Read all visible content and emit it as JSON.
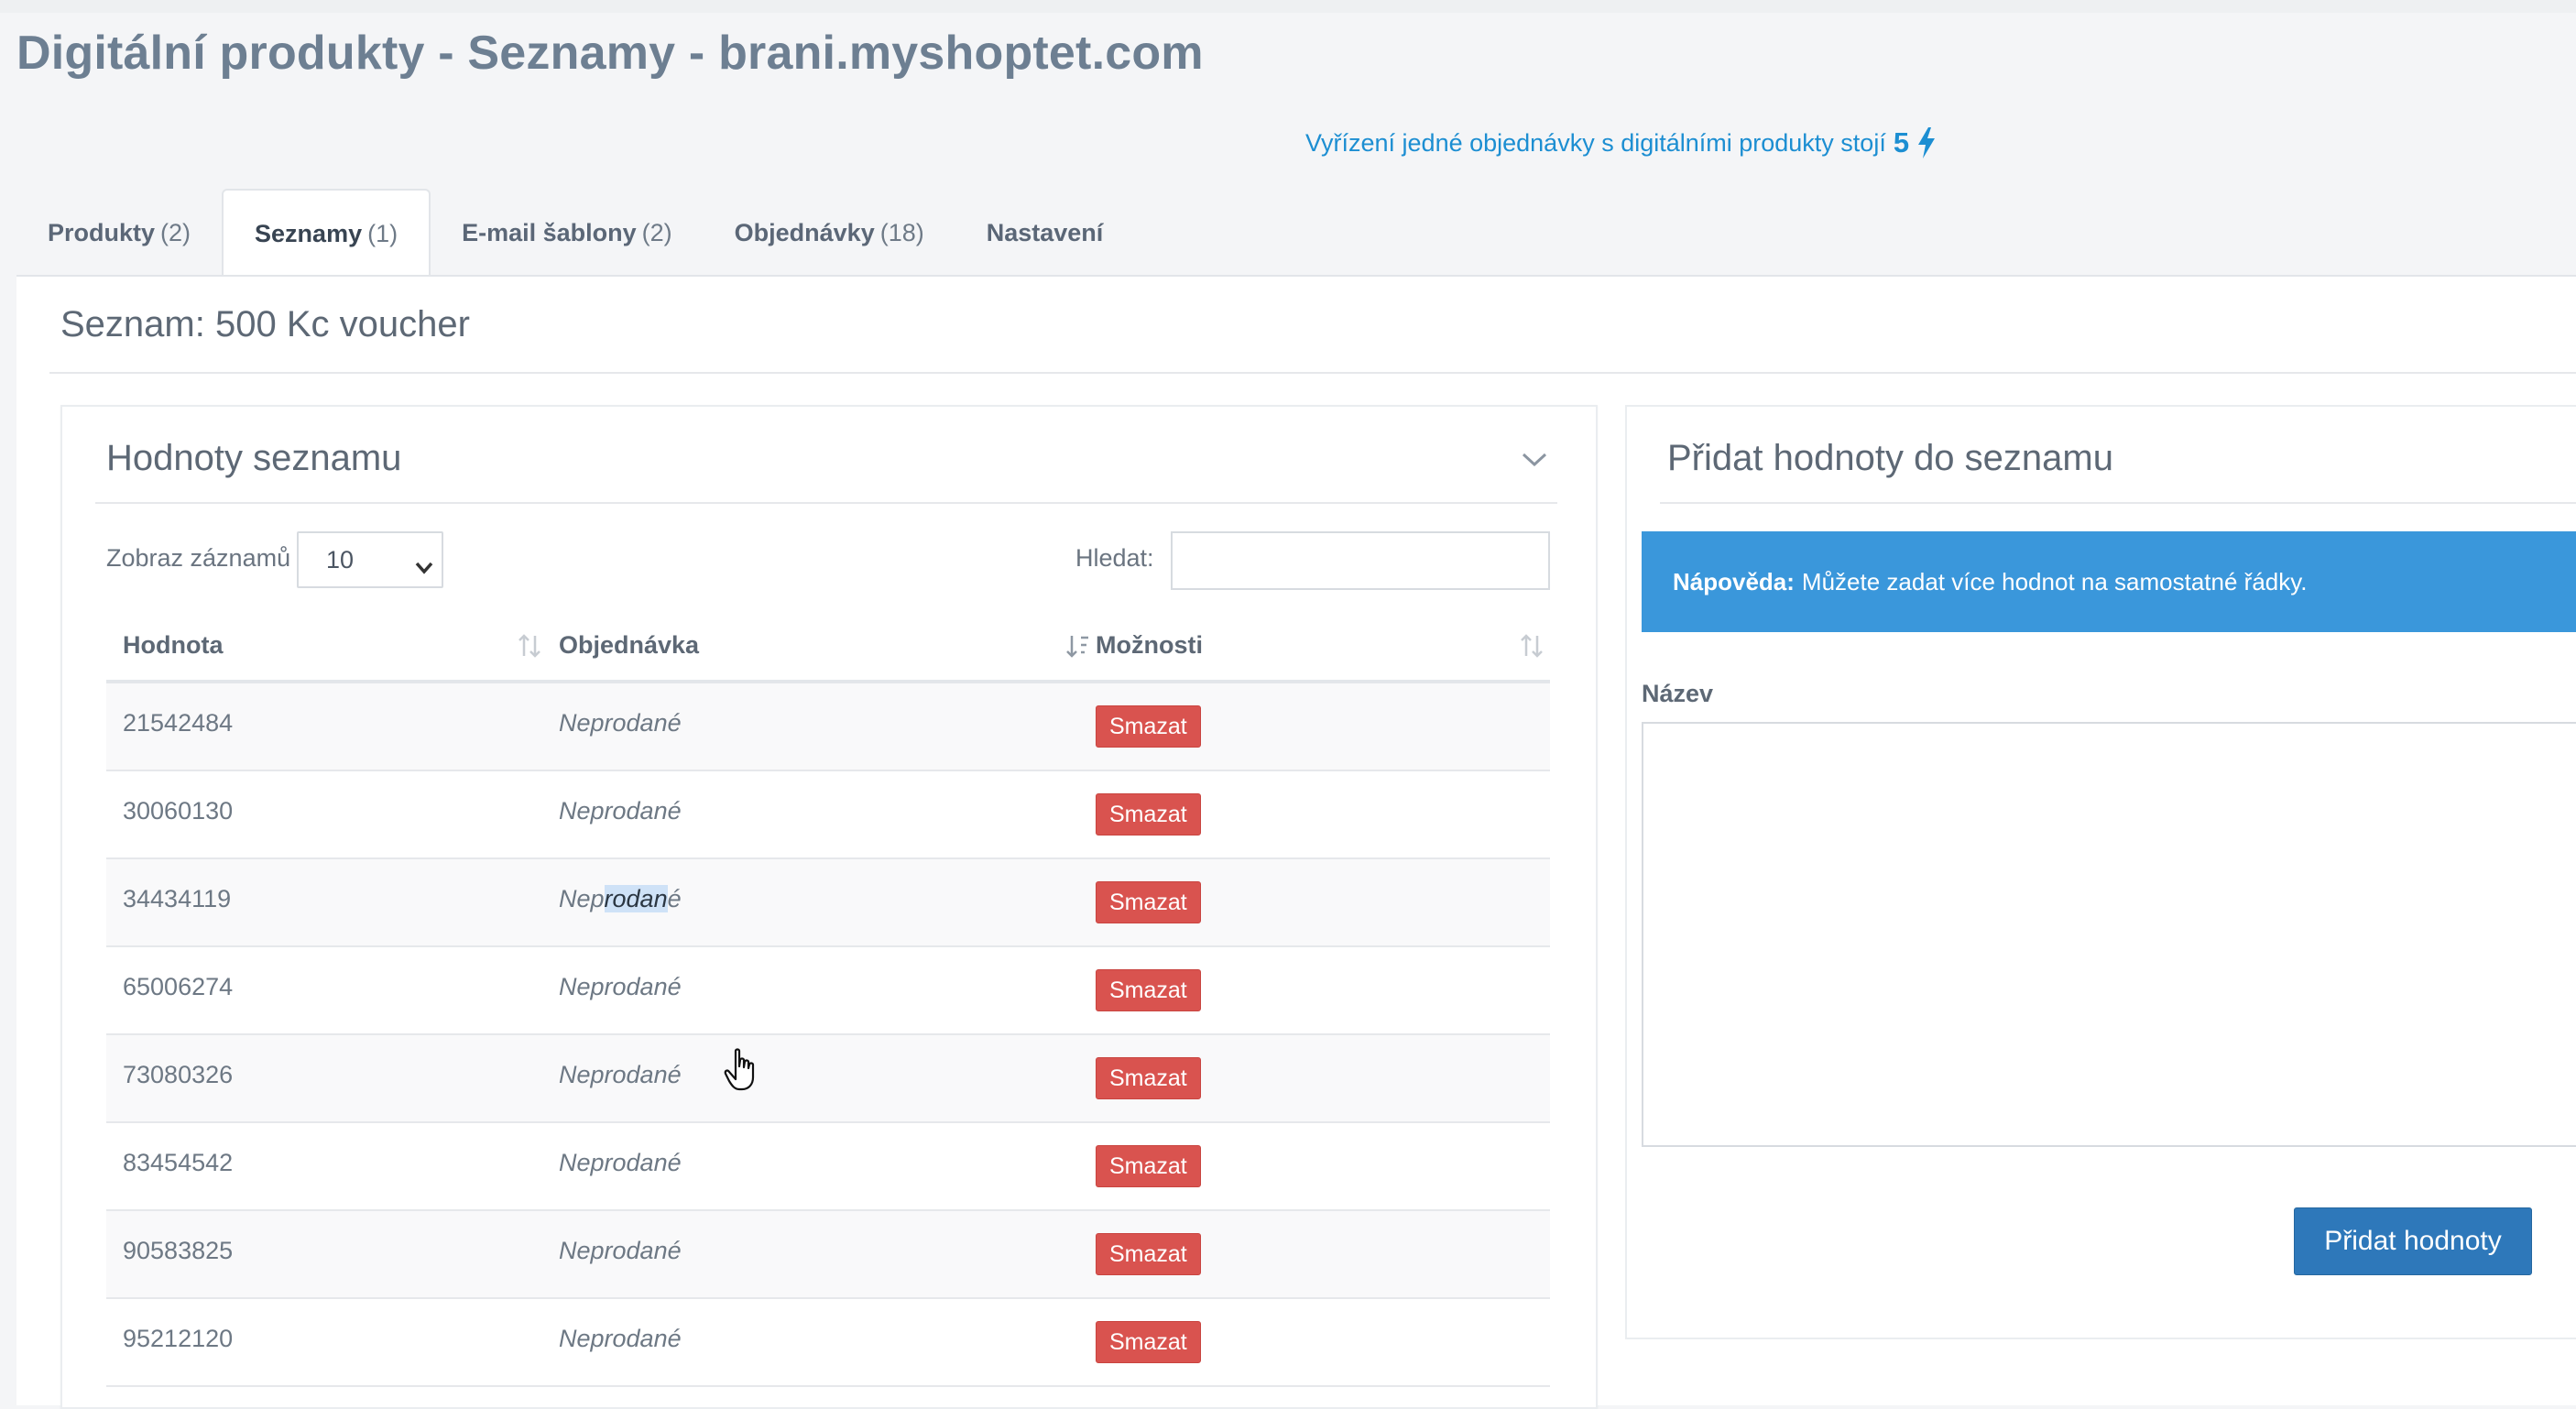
{
  "page": {
    "title": "Digitální produkty - Seznamy - brani.myshoptet.com",
    "credit_note": {
      "text": "Vyřízení jedné objednávky s digitálními produkty stojí",
      "amount": "5",
      "icon": "lightning-bolt-icon"
    }
  },
  "tabs": [
    {
      "label": "Produkty",
      "count": "(2)",
      "active": false
    },
    {
      "label": "Seznamy",
      "count": "(1)",
      "active": true
    },
    {
      "label": "E-mail šablony",
      "count": "(2)",
      "active": false
    },
    {
      "label": "Objednávky",
      "count": "(18)",
      "active": false
    },
    {
      "label": "Nastavení",
      "count": "",
      "active": false
    }
  ],
  "list": {
    "heading": "Seznam: 500 Kc voucher"
  },
  "values_card": {
    "title": "Hodnoty seznamu",
    "length_label": "Zobraz záznamů",
    "length_value": "10",
    "search_label": "Hledat:",
    "search_value": "",
    "columns": [
      "Hodnota",
      "Objednávka",
      "Možnosti"
    ],
    "rows": [
      {
        "value": "21542484",
        "status": "Neprodané",
        "action": "Smazat"
      },
      {
        "value": "30060130",
        "status": "Neprodané",
        "action": "Smazat"
      },
      {
        "value": "34434119",
        "status": "Neprodané",
        "action": "Smazat"
      },
      {
        "value": "65006274",
        "status": "Neprodané",
        "action": "Smazat"
      },
      {
        "value": "73080326",
        "status": "Neprodané",
        "action": "Smazat"
      },
      {
        "value": "83454542",
        "status": "Neprodané",
        "action": "Smazat"
      },
      {
        "value": "90583825",
        "status": "Neprodané",
        "action": "Smazat"
      },
      {
        "value": "95212120",
        "status": "Neprodané",
        "action": "Smazat"
      }
    ],
    "selected_text": {
      "before": "Nep",
      "selected": "rodan",
      "after": "é"
    }
  },
  "add_card": {
    "title": "Přidat hodnoty do seznamu",
    "hint_label": "Nápověda:",
    "hint_text": "Můžete zadat více hodnot na samostatné řádky.",
    "name_label": "Název",
    "name_value": "",
    "submit_label": "Přidat hodnoty"
  },
  "colors": {
    "accent_blue": "#1c8ed2",
    "hint_blue": "#3a97db",
    "button_blue": "#2e78ba",
    "danger_red": "#d9534f"
  }
}
